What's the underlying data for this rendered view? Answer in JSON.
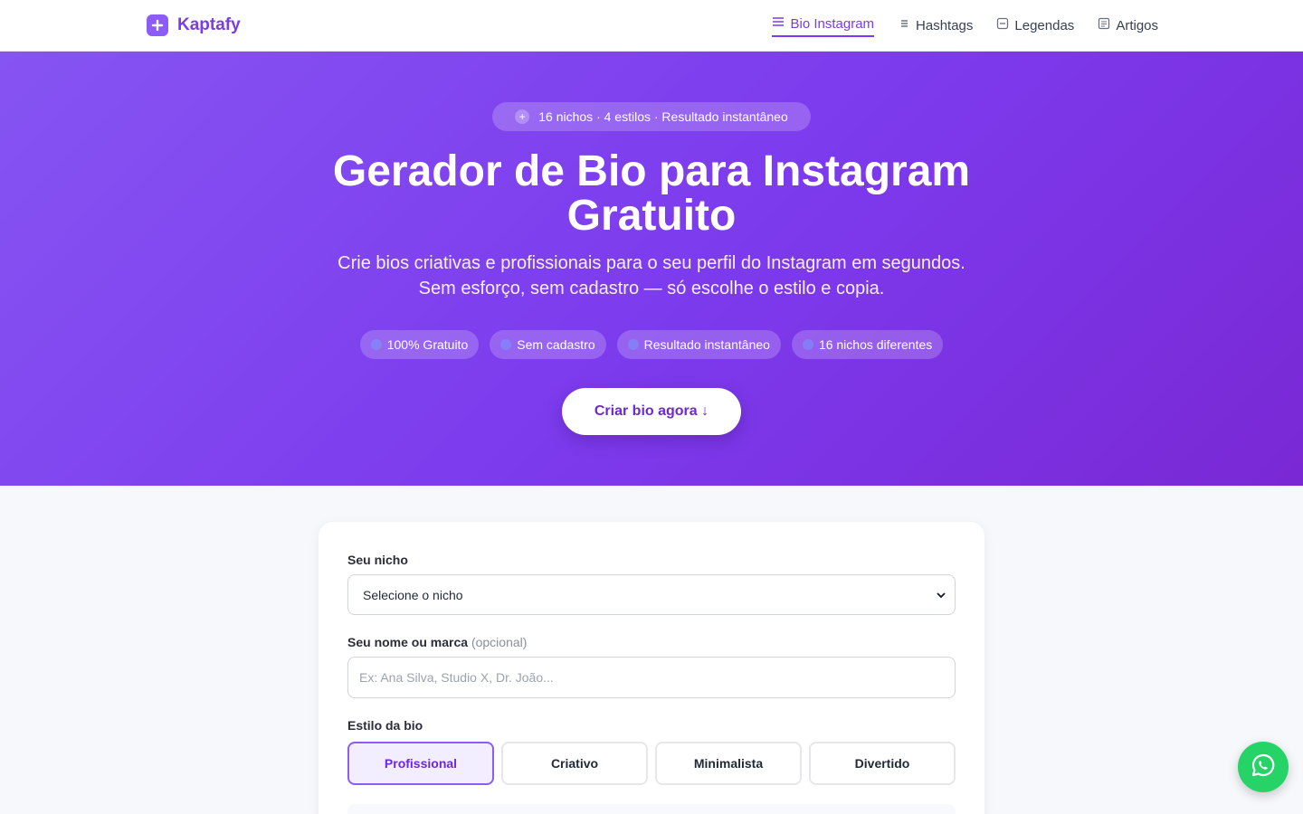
{
  "brand": {
    "name": "Kaptafy"
  },
  "nav": {
    "items": [
      {
        "label": "Bio Instagram",
        "icon": "menu-lines-icon",
        "active": true
      },
      {
        "label": "Hashtags",
        "icon": "list-icon",
        "active": false
      },
      {
        "label": "Legendas",
        "icon": "caption-box-icon",
        "active": false
      },
      {
        "label": "Artigos",
        "icon": "article-icon",
        "active": false
      }
    ]
  },
  "hero": {
    "pill": "16 nichos · 4 estilos · Resultado instantâneo",
    "title": "Gerador de Bio para Instagram Gratuito",
    "subtitle": "Crie bios criativas e profissionais para o seu perfil do Instagram em segundos. Sem esforço, sem cadastro — só escolhe o estilo e copia.",
    "badges": [
      "100% Gratuito",
      "Sem cadastro",
      "Resultado instantâneo",
      "16 nichos diferentes"
    ],
    "cta": "Criar bio agora ↓"
  },
  "form": {
    "niche_label": "Seu nicho",
    "niche_selected": "Selecione o nicho",
    "name_label": "Seu nome ou marca",
    "name_optional": "(opcional)",
    "name_placeholder": "Ex: Ana Silva, Studio X, Dr. João...",
    "name_value": "",
    "style_label": "Estilo da bio",
    "styles": [
      "Profissional",
      "Criativo",
      "Minimalista",
      "Divertido"
    ],
    "style_selected": "Profissional"
  },
  "colors": {
    "accent": "#7c3aed",
    "hero_start": "#8654f2",
    "hero_end": "#7a28d4",
    "whatsapp": "#25d366"
  }
}
